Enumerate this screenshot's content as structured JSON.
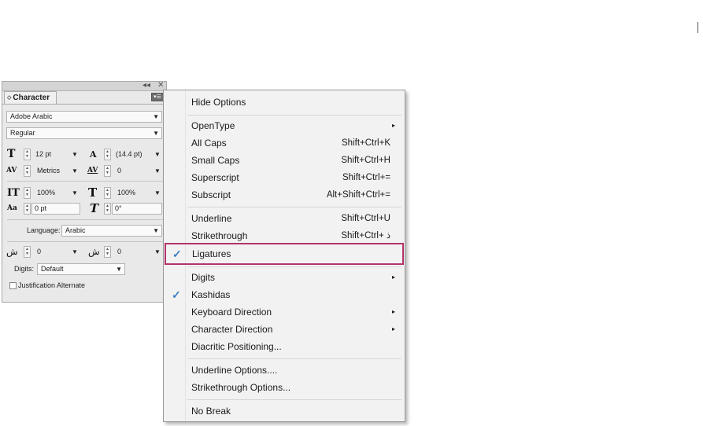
{
  "panel": {
    "collapse_glyph": "◂◂",
    "close_glyph": "✕",
    "tab_label": "Character",
    "tab_arrows": "◇",
    "menu_button_glyph": "▾☰",
    "font_family": "Adobe Arabic",
    "font_style": "Regular",
    "font_size": "12 pt",
    "leading": "(14.4 pt)",
    "kerning": "Metrics",
    "tracking": "0",
    "vertical_scale": "100%",
    "horizontal_scale": "100%",
    "baseline_shift": "0 pt",
    "skew": "0°",
    "language_label": "Language:",
    "language": "Arabic",
    "arabic_field_1": "0",
    "arabic_field_2": "0",
    "digits_label": "Digits:",
    "digits": "Default",
    "justification_label": "Justification Alternate"
  },
  "menu": {
    "items": [
      {
        "label": "Hide Options"
      },
      {
        "label": "OpenType",
        "submenu": "▸"
      },
      {
        "label": "All Caps",
        "shortcut": "Shift+Ctrl+K"
      },
      {
        "label": "Small Caps",
        "shortcut": "Shift+Ctrl+H"
      },
      {
        "label": "Superscript",
        "shortcut": "Shift+Ctrl+="
      },
      {
        "label": "Subscript",
        "shortcut": "Alt+Shift+Ctrl+="
      },
      {
        "label": "Underline",
        "shortcut": "Shift+Ctrl+U"
      },
      {
        "label": "Strikethrough",
        "shortcut": "Shift+Ctrl+ ذ"
      },
      {
        "label": "Ligatures",
        "checked": "✓"
      },
      {
        "label": "Digits",
        "submenu": "▸"
      },
      {
        "label": "Kashidas",
        "checked": "✓"
      },
      {
        "label": "Keyboard Direction",
        "submenu": "▸"
      },
      {
        "label": "Character Direction",
        "submenu": "▸"
      },
      {
        "label": "Diacritic Positioning..."
      },
      {
        "label": "Underline Options...."
      },
      {
        "label": "Strikethrough Options..."
      },
      {
        "label": "No Break"
      }
    ]
  },
  "icons": {
    "font_size": "T",
    "leading": "A",
    "kerning": "AV",
    "tracking": "AV",
    "vertical_scale": "IT",
    "horizontal_scale": "T",
    "baseline_shift": "Aa",
    "skew": "T",
    "arabic_1": "ش",
    "arabic_2": "ش"
  },
  "colors": {
    "highlight_border": "#b3336b",
    "checkmark": "#3b7fc4"
  }
}
